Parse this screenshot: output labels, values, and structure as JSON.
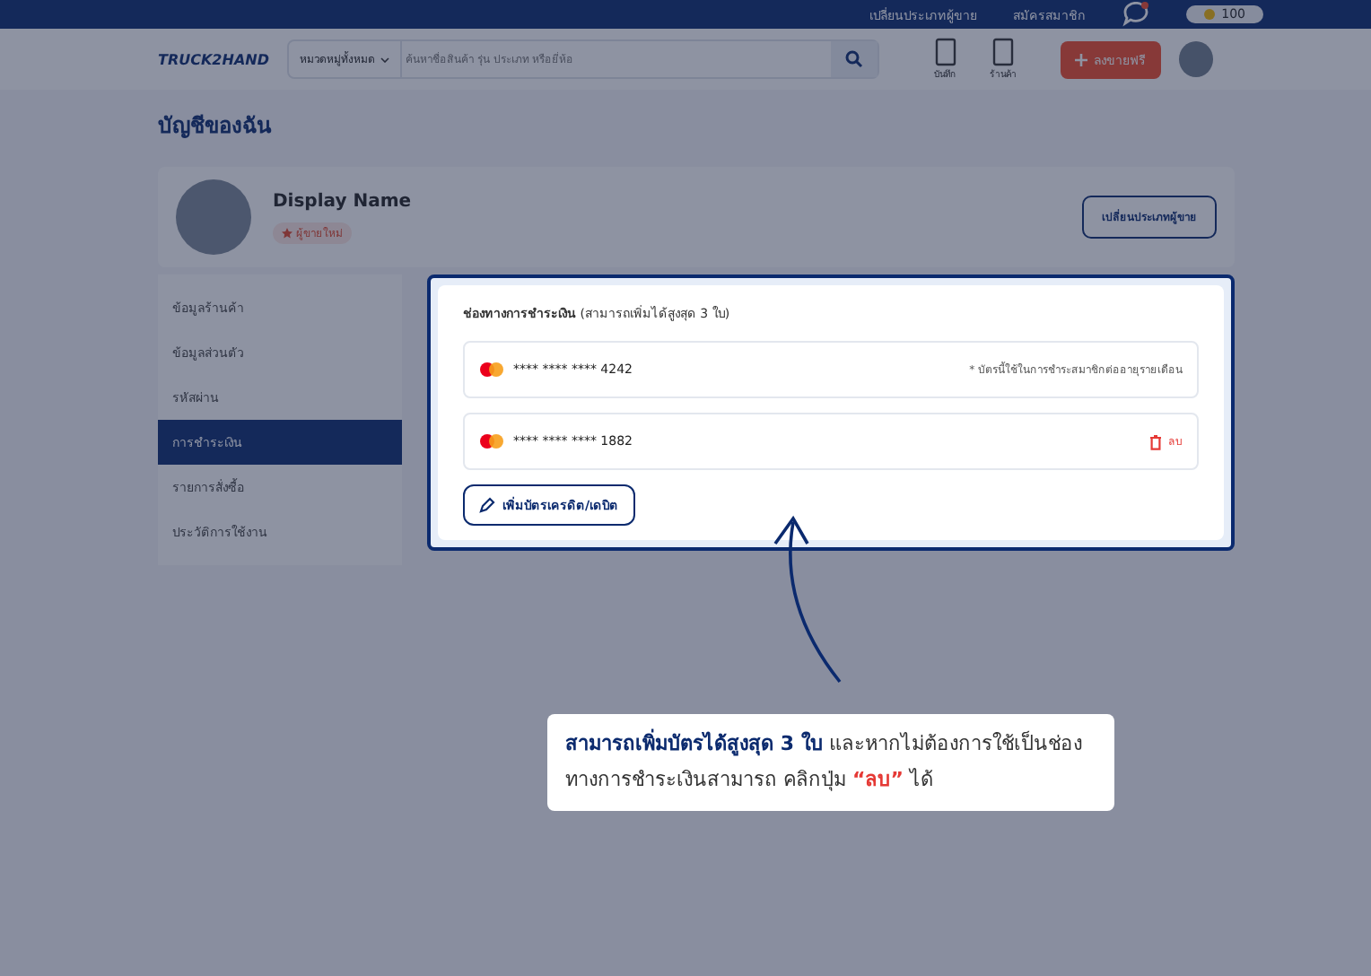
{
  "top_bar": {
    "links": [
      "เปลี่ยนประเภทผู้ขาย",
      "สมัครสมาชิก"
    ],
    "coins": "100"
  },
  "header": {
    "logo": "TRUCK2HAND",
    "category": "หมวดหมู่ทั้งหมด",
    "search_placeholder": "ค้นหาชื่อสินค้า รุ่น ประเภท หรือยี่ห้อ",
    "icons": [
      "บันทึก",
      "ร้านค้า"
    ],
    "sell_button": "ลงขายฟรี"
  },
  "page_title": "บัญชีของฉัน",
  "profile": {
    "name": "Display Name",
    "badge": "ผู้ขายใหม่",
    "button": "เปลี่ยนประเภทผู้ขาย"
  },
  "sidebar": {
    "items": [
      {
        "label": "ข้อมูลร้านค้า",
        "selected": false
      },
      {
        "label": "ข้อมูลส่วนตัว",
        "selected": false
      },
      {
        "label": "รหัสผ่าน",
        "selected": false
      },
      {
        "label": "การชำระเงิน",
        "selected": true
      },
      {
        "label": "รายการสั่งซื้อ",
        "selected": false
      },
      {
        "label": "ประวัติการใช้งาน",
        "selected": false
      }
    ]
  },
  "payment": {
    "title": "**ช่องทางการชำระเงิน** (สามารถเพิ่มได้สูงสุด 3 ใบ)",
    "cards": [
      {
        "number": "**** **** **** 4242",
        "kind": "note",
        "note": "* บัตรนี้ใช้ในการชำระสมาชิกต่ออายุรายเดือน"
      },
      {
        "number": "**** **** **** 1882",
        "kind": "delete",
        "note": "ลบ"
      }
    ],
    "add_button": "เพิ่มบัตรเครดิต/เดบิต"
  },
  "callout": {
    "parts": [
      {
        "text": "สามารถเพิ่มบัตรได้สูงสุด 3 ใบ",
        "kind": "highlight"
      },
      {
        "text": " และหากไม่ต้องการใช้เป็นช่องทางการชำระเงินสามารถ คลิกปุ่ม ",
        "kind": "plain"
      },
      {
        "text": "“ลบ”",
        "kind": "danger"
      },
      {
        "text": " ได้",
        "kind": "plain"
      }
    ]
  }
}
